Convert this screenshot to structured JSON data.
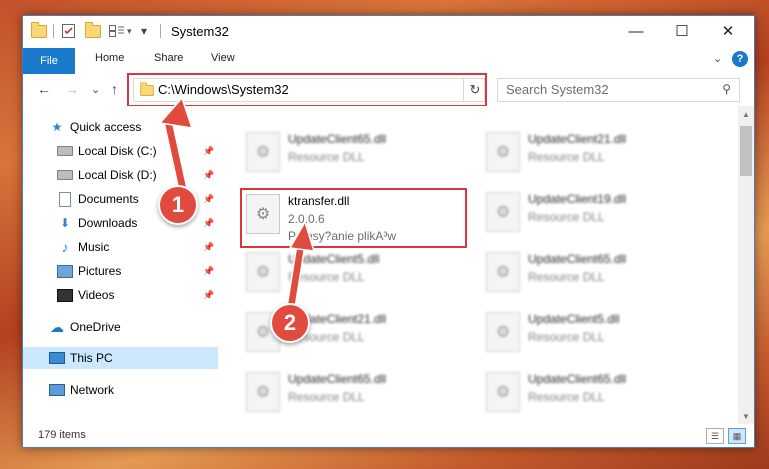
{
  "window": {
    "title": "System32",
    "controls": {
      "minimize": "—",
      "maximize": "☐",
      "close": "✕"
    },
    "qat": {
      "dropdown": "▾"
    }
  },
  "ribbon": {
    "tabs": [
      "File",
      "Home",
      "Share",
      "View"
    ],
    "expand_glyph": "⌄",
    "help_glyph": "?"
  },
  "nav": {
    "back": "←",
    "forward": "→",
    "recent": "⌄",
    "up": "↑",
    "address": "C:\\Windows\\System32",
    "address_dropdown": "⌄",
    "refresh": "↻",
    "search_placeholder": "Search System32",
    "search_glyph": "⚲"
  },
  "sidebar": {
    "items": [
      {
        "label": "Quick access",
        "icon": "star-icon",
        "glyph": "★"
      },
      {
        "label": "Local Disk (C:)",
        "icon": "drive-icon",
        "pinned": true
      },
      {
        "label": "Local Disk (D:)",
        "icon": "drive-icon",
        "pinned": true
      },
      {
        "label": "Documents",
        "icon": "document-icon",
        "pinned": true
      },
      {
        "label": "Downloads",
        "icon": "download-icon",
        "glyph": "⬇",
        "pinned": true
      },
      {
        "label": "Music",
        "icon": "music-icon",
        "glyph": "♪",
        "pinned": true
      },
      {
        "label": "Pictures",
        "icon": "pictures-icon",
        "pinned": true
      },
      {
        "label": "Videos",
        "icon": "videos-icon",
        "pinned": true
      },
      {
        "label": "OneDrive",
        "icon": "cloud-icon",
        "glyph": "☁"
      },
      {
        "label": "This PC",
        "icon": "computer-icon",
        "selected": true
      },
      {
        "label": "Network",
        "icon": "network-icon"
      }
    ],
    "pin_glyph": "📌"
  },
  "files": {
    "left_column": [
      {
        "name": "UpdateClient65.dll",
        "type": "Resource DLL"
      },
      {
        "name": "ktransfer.dll",
        "version": "2.0.0.6",
        "description": "Przesy?anie plikA³w",
        "highlighted": true
      },
      {
        "name": "UpdateClient5.dll",
        "type": "Resource DLL"
      },
      {
        "name": "UpdateClient21.dll",
        "type": "Resource DLL"
      },
      {
        "name": "UpdateClient65.dll",
        "type": "Resource DLL"
      }
    ],
    "right_column": [
      {
        "name": "UpdateClient21.dll",
        "type": "Resource DLL"
      },
      {
        "name": "UpdateClient19.dll",
        "type": "Resource DLL"
      },
      {
        "name": "UpdateClient65.dll",
        "type": "Resource DLL"
      },
      {
        "name": "UpdateClient5.dll",
        "type": "Resource DLL"
      },
      {
        "name": "UpdateClient65.dll",
        "type": "Resource DLL"
      }
    ],
    "file_icon_glyph": "⚙"
  },
  "scrollbar": {
    "up": "▲",
    "down": "▼"
  },
  "status": {
    "item_count": "179 items",
    "details_glyph": "☰",
    "tiles_glyph": "▦"
  },
  "annotations": [
    {
      "label": "1",
      "color": "#e14b3d"
    },
    {
      "label": "2",
      "color": "#e14b3d"
    }
  ],
  "colors": {
    "accent": "#1979ca",
    "highlight": "#d9373d",
    "selection": "#cce8ff"
  }
}
